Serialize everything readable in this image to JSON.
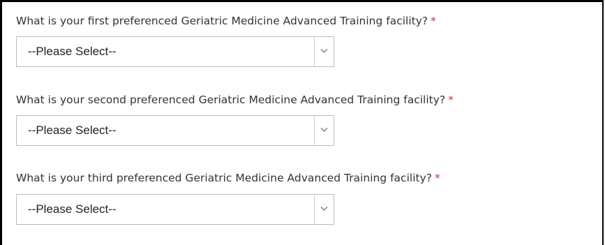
{
  "form": {
    "required_marker": "*",
    "questions": [
      {
        "label": "What is your first preferenced Geriatric Medicine Advanced Training facility?",
        "selected": "--Please Select--",
        "icon": "chevron-down-icon"
      },
      {
        "label": "What is your second preferenced Geriatric Medicine Advanced Training facility?",
        "selected": "--Please Select--",
        "icon": "chevron-down-icon"
      },
      {
        "label": "What is your third preferenced Geriatric Medicine Advanced Training facility?",
        "selected": "--Please Select--",
        "icon": "chevron-down-icon"
      }
    ]
  },
  "colors": {
    "text": "#333333",
    "required": "#cc3333",
    "select_border": "#bdbdbd",
    "frame_border": "#000000"
  }
}
